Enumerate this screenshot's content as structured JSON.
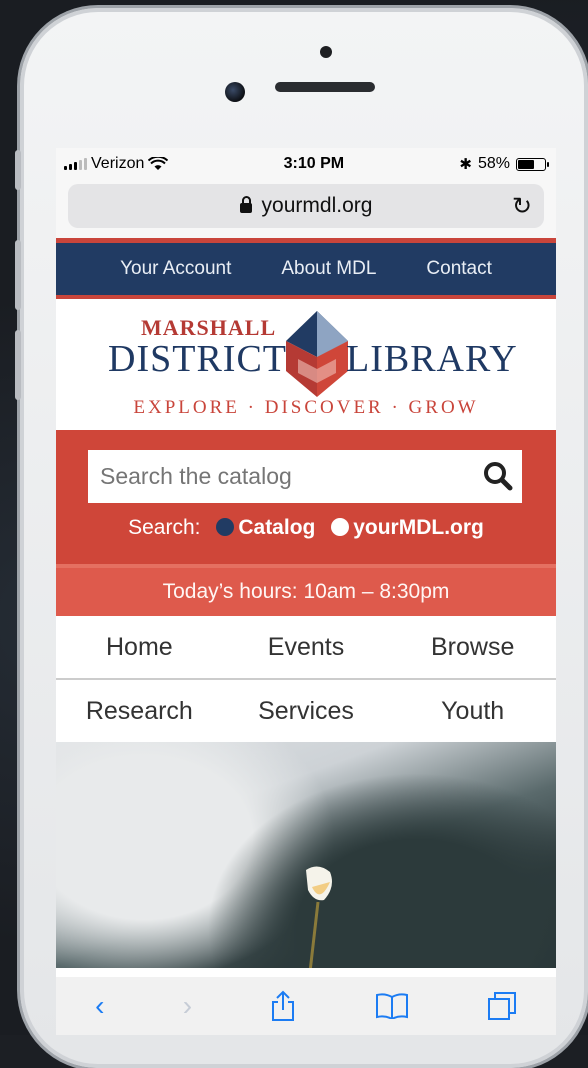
{
  "status": {
    "carrier": "Verizon",
    "time": "3:10 PM",
    "battery": "58%",
    "battery_level": 0.58
  },
  "browser": {
    "url": "yourmdl.org"
  },
  "site": {
    "top_nav": [
      "Your Account",
      "About MDL",
      "Contact"
    ],
    "logo": {
      "line1": "MARSHALL",
      "line2a": "DISTRICT",
      "line2b": "LIBRARY",
      "tagline": "EXPLORE · DISCOVER · GROW"
    },
    "search": {
      "placeholder": "Search the catalog",
      "label": "Search:",
      "option_catalog": "Catalog",
      "option_site": "yourMDL.org"
    },
    "hours": "Today’s hours: 10am – 8:30pm",
    "main_nav": {
      "row1": [
        "Home",
        "Events",
        "Browse"
      ],
      "row2": [
        "Research",
        "Services",
        "Youth"
      ]
    }
  },
  "colors": {
    "navy": "#213b63",
    "red": "#cf4639",
    "hours_red": "#de5a4c",
    "safari_blue": "#1c7cf3"
  },
  "toolbar_icons": [
    "back-icon",
    "forward-icon",
    "share-icon",
    "bookmarks-icon",
    "tabs-icon"
  ]
}
